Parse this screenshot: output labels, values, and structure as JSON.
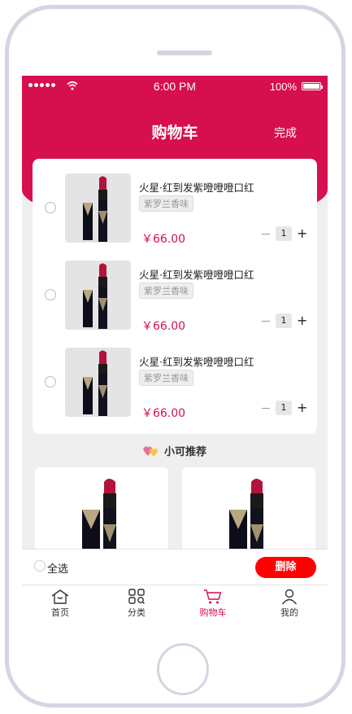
{
  "status_bar": {
    "time": "6:00 PM",
    "battery": "100%"
  },
  "header": {
    "title": "购物车",
    "done_label": "完成"
  },
  "cart": {
    "items": [
      {
        "title": "火星·红到发紫噔噔噔口红",
        "variant": "紫罗兰香味",
        "price": "￥66.00",
        "quantity": "1"
      },
      {
        "title": "火星·红到发紫噔噔噔口红",
        "variant": "紫罗兰香味",
        "price": "￥66.00",
        "quantity": "1"
      },
      {
        "title": "火星·红到发紫噔噔噔口红",
        "variant": "紫罗兰香味",
        "price": "￥66.00",
        "quantity": "1"
      }
    ]
  },
  "recommend": {
    "title": "小可推荐"
  },
  "bottom_bar": {
    "select_all_label": "全选",
    "delete_label": "删除"
  },
  "tabs": [
    {
      "label": "首页",
      "icon": "home-icon",
      "active": false
    },
    {
      "label": "分类",
      "icon": "category-icon",
      "active": false
    },
    {
      "label": "购物车",
      "icon": "cart-icon",
      "active": true
    },
    {
      "label": "我的",
      "icon": "user-icon",
      "active": false
    }
  ],
  "colors": {
    "accent": "#d60f4f",
    "delete": "#ff0000"
  }
}
